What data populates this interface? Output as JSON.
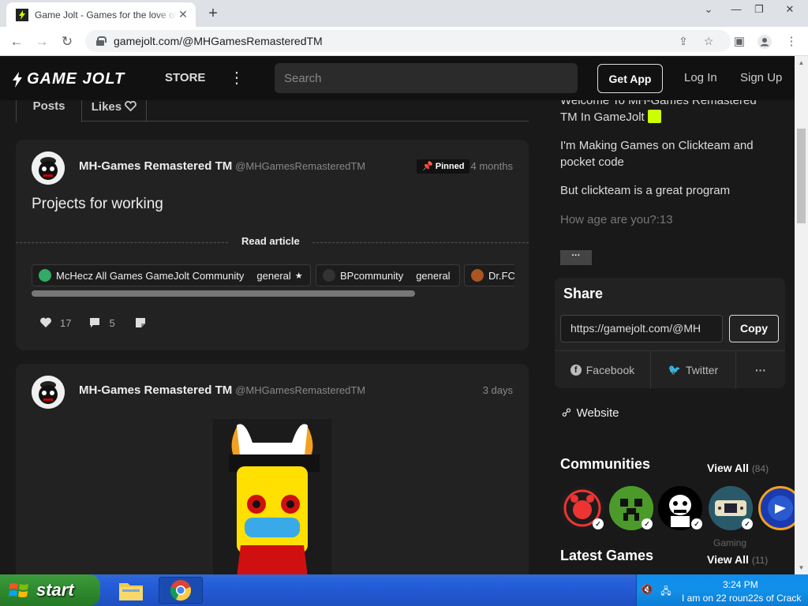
{
  "browser": {
    "tab_title": "Game Jolt - Games for the love of",
    "url": "gamejolt.com/@MHGamesRemasteredTM"
  },
  "header": {
    "store": "STORE",
    "search_placeholder": "Search",
    "get_app": "Get App",
    "login": "Log In",
    "signup": "Sign Up",
    "logo_text": "GAME JOLT"
  },
  "profile_tabs": {
    "posts": "Posts",
    "likes": "Likes"
  },
  "posts": [
    {
      "author": "MH-Games Remastered TM",
      "handle": "@MHGamesRemasteredTM",
      "pinned": "Pinned",
      "time": "4 months",
      "title": "Projects for working",
      "read_article": "Read article",
      "chips": [
        {
          "name": "McHecz All Games GameJolt Community",
          "channel": "general"
        },
        {
          "name": "BPcommunity",
          "channel": "general"
        },
        {
          "name": "Dr.FC",
          "channel": ""
        }
      ],
      "likes": "17",
      "comments": "5"
    },
    {
      "author": "MH-Games Remastered TM",
      "handle": "@MHGamesRemasteredTM",
      "time": "3 days"
    }
  ],
  "bio": {
    "line1a": "Welcome To MH-Games Remastered",
    "line1b": "TM In GameJolt",
    "line2a": "I'm Making Games on Clickteam and",
    "line2b": "pocket code",
    "line3": "But clickteam is a great program",
    "line4": "How age are you?:13",
    "more": "···"
  },
  "share": {
    "title": "Share",
    "url": "https://gamejolt.com/@MH",
    "copy": "Copy",
    "facebook": "Facebook",
    "twitter": "Twitter",
    "more": "···"
  },
  "website": "Website",
  "communities": {
    "title": "Communities",
    "view_all": "View All",
    "count": "(84)",
    "gaming_label": "Gaming"
  },
  "latest_games": {
    "title": "Latest Games",
    "view_all": "View All",
    "count": "(11)"
  },
  "taskbar": {
    "start": "start",
    "clock": "3:24 PM",
    "note": "I am on 22 roun22s of Crack"
  }
}
